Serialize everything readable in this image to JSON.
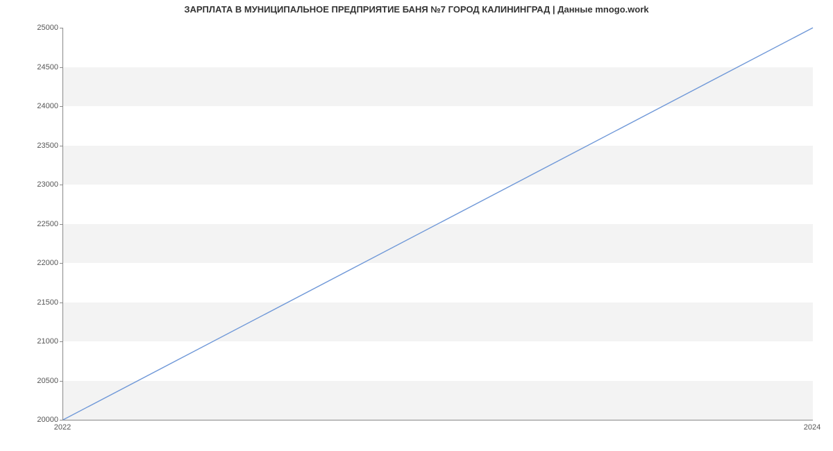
{
  "chart_data": {
    "type": "line",
    "title": "ЗАРПЛАТА В МУНИЦИПАЛЬНОЕ ПРЕДПРИЯТИЕ БАНЯ №7 ГОРОД КАЛИНИНГРАД | Данные mnogo.work",
    "xlabel": "",
    "ylabel": "",
    "x": [
      2022,
      2024
    ],
    "values": [
      20000,
      25000
    ],
    "x_ticks": [
      2022,
      2024
    ],
    "y_ticks": [
      20000,
      20500,
      21000,
      21500,
      22000,
      22500,
      23000,
      23500,
      24000,
      24500,
      25000
    ],
    "xlim": [
      2022,
      2024
    ],
    "ylim": [
      20000,
      25000
    ],
    "line_color": "#6f98d8",
    "grid": true
  }
}
